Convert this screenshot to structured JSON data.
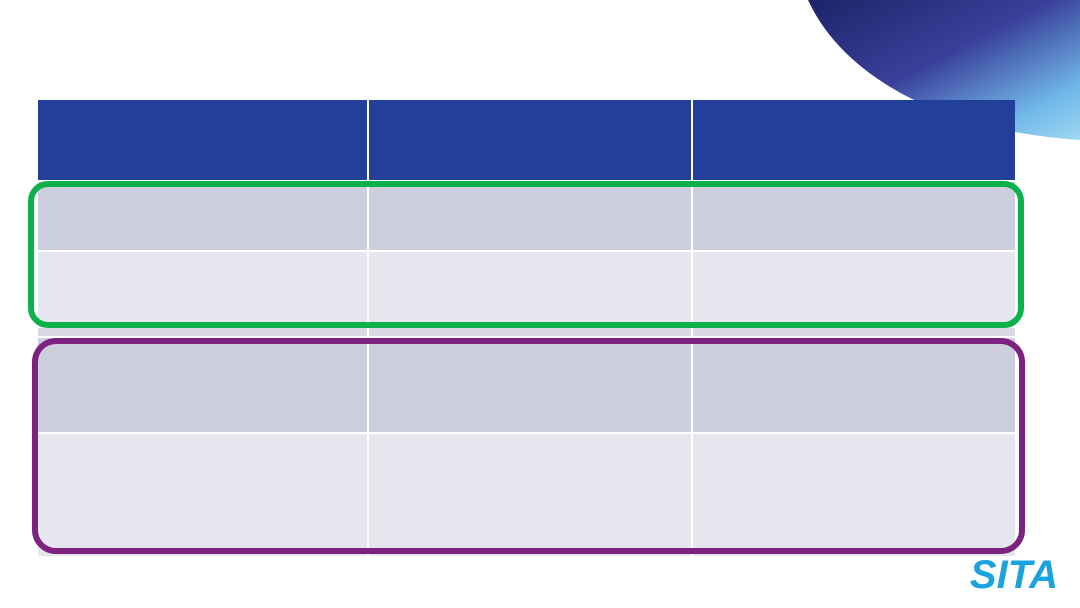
{
  "logo": {
    "text": "SITA",
    "color": "#1aa3dd"
  },
  "table": {
    "header_color": "#22409a",
    "band_dark_color": "#cdcfdf",
    "band_light_color": "#e6e7ee",
    "header": [
      "",
      "",
      ""
    ],
    "rows": [
      [
        "",
        "",
        ""
      ],
      [
        "",
        "",
        ""
      ],
      [
        "",
        "",
        ""
      ],
      [
        "",
        "",
        ""
      ]
    ]
  },
  "highlights": [
    {
      "name": "green-group",
      "color": "#0db14b"
    },
    {
      "name": "purple-group",
      "color": "#7d237f"
    }
  ]
}
